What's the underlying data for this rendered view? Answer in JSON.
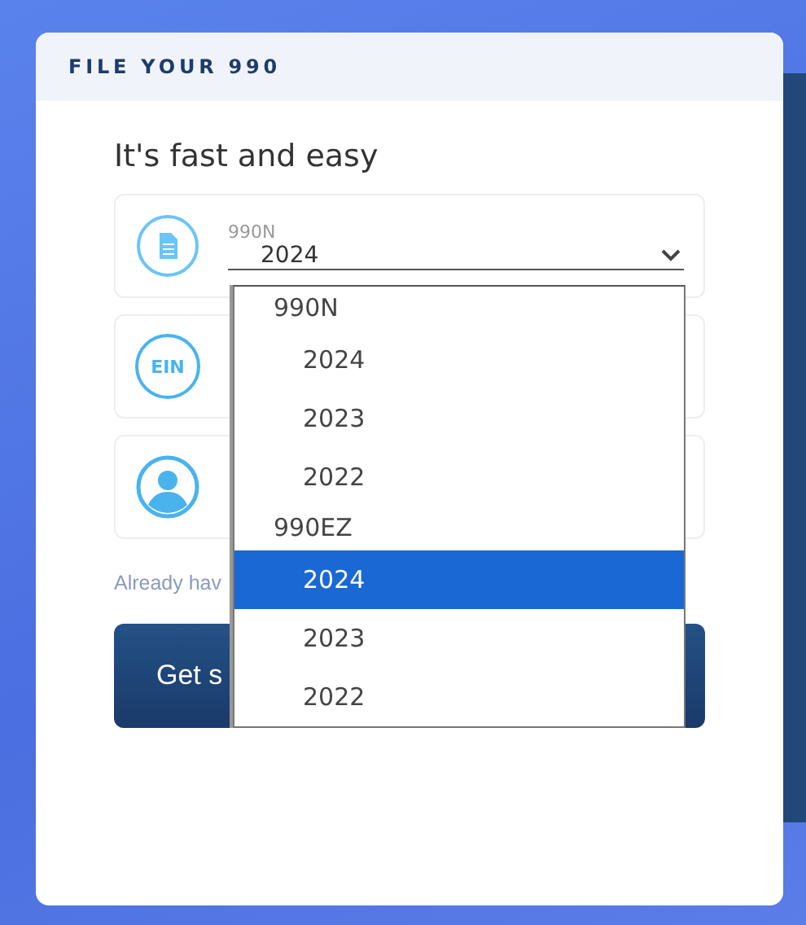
{
  "header": {
    "title": "FILE YOUR 990"
  },
  "tagline": "It's fast and easy",
  "fields": [
    {
      "kind": "form-select",
      "label": "990N",
      "value": "2024"
    },
    {
      "kind": "ein",
      "icon_text": "EIN"
    },
    {
      "kind": "person"
    }
  ],
  "note": "Already hav",
  "button": "Get s",
  "dropdown": {
    "groups": [
      {
        "label": "990N",
        "options": [
          {
            "label": "2024",
            "selected": false
          },
          {
            "label": "2023",
            "selected": false
          },
          {
            "label": "2022",
            "selected": false
          }
        ]
      },
      {
        "label": "990EZ",
        "options": [
          {
            "label": "2024",
            "selected": true
          },
          {
            "label": "2023",
            "selected": false
          },
          {
            "label": "2022",
            "selected": false
          }
        ]
      }
    ]
  }
}
